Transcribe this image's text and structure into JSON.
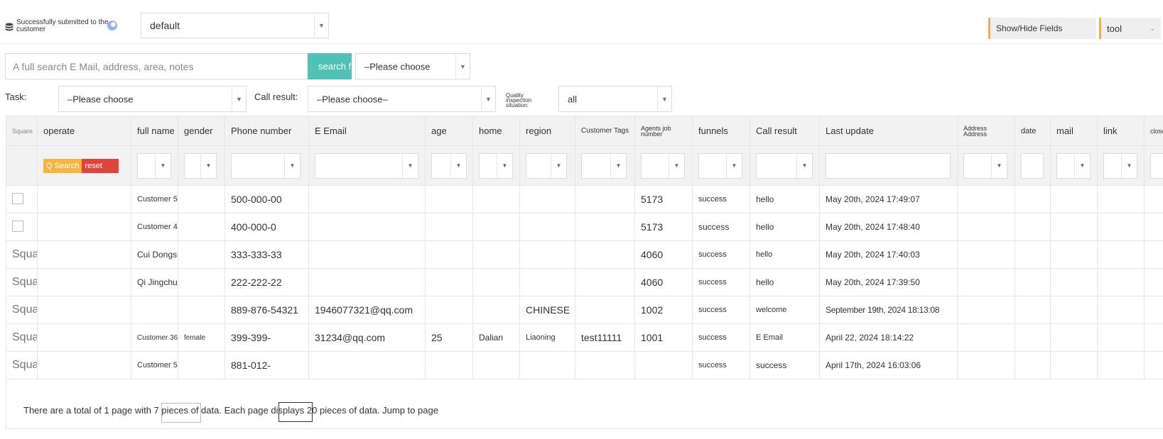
{
  "topbar": {
    "status_text": "Successfully submitted to the customer",
    "view_select": "default",
    "show_hide_label": "Show/Hide Fields",
    "tool_label": "tool"
  },
  "search": {
    "placeholder": "A full search E Mail, address, area, notes",
    "button_label": "search f",
    "choose": "–Please choose"
  },
  "filters": {
    "task_label": "Task:",
    "task_value": "–Please choose",
    "call_label": "Call result:",
    "call_value": "–Please choose–",
    "quality_label": "Quality inspection situation:",
    "quality_value": "all"
  },
  "table": {
    "columns": [
      "Square",
      "operate",
      "full name",
      "gender",
      "Phone number",
      "E Email",
      "age",
      "home",
      "region",
      "Customer Tags",
      "Agents job number",
      "funnels",
      "Call result",
      "Last update",
      "Address Address",
      "date",
      "mail",
      "link",
      "close"
    ],
    "qsearch_label": "Q Search",
    "reset_label": "reset",
    "rows": [
      {
        "square": "",
        "name": "Customer 5",
        "gender": "",
        "phone": "500-000-00",
        "email": "",
        "age": "",
        "home": "",
        "region": "",
        "tags": "",
        "agent": "5173",
        "funnel": "success",
        "call": "hello",
        "updated": "May 20th, 2024 17:49:07"
      },
      {
        "square": "",
        "name": "Customer 4",
        "gender": "",
        "phone": "400-000-0",
        "email": "",
        "age": "",
        "home": "",
        "region": "",
        "tags": "",
        "agent": "5173",
        "funnel": "success",
        "call": "hello",
        "updated": "May 20th, 2024 17:48:40"
      },
      {
        "square": "Square",
        "name": "Cui Dongshan",
        "gender": "",
        "phone": "333-333-33",
        "email": "",
        "age": "",
        "home": "",
        "region": "",
        "tags": "",
        "agent": "4060",
        "funnel": "success",
        "call": "hello",
        "updated": "May 20th, 2024 17:40:03"
      },
      {
        "square": "Square",
        "name": "Qi Jingchun",
        "gender": "",
        "phone": "222-222-22",
        "email": "",
        "age": "",
        "home": "",
        "region": "",
        "tags": "",
        "agent": "4060",
        "funnel": "success",
        "call": "hello",
        "updated": "May 20th, 2024 17:39:50"
      },
      {
        "square": "Square",
        "name": "",
        "gender": "",
        "phone": "889-876-54321",
        "email": "1946077321@qq.com",
        "age": "",
        "home": "",
        "region": "CHINESE",
        "tags": "",
        "agent": "1002",
        "funnel": "success",
        "call": "welcome",
        "updated": "September 19th, 2024 18:13:08"
      },
      {
        "square": "Square",
        "name": "Customer 36",
        "gender": "female",
        "phone": "399-399-",
        "email": "31234@qq.com",
        "age": "25",
        "home": "Dalian",
        "region": "Liaoning",
        "tags": "test11111",
        "agent": "1001",
        "funnel": "success",
        "call": "E Email",
        "updated": "April 22, 2024 18:14:22"
      },
      {
        "square": "Square",
        "name": "Customer 5",
        "gender": "",
        "phone": "881-012-",
        "email": "",
        "age": "",
        "home": "",
        "region": "",
        "tags": "",
        "agent": "",
        "funnel": "success",
        "call": "success",
        "updated": "April 17th, 2024 16:03:06"
      }
    ]
  },
  "pager": {
    "text": "There are a total of 1 page with 7 pieces of data. Each page displays 20 pieces of data. Jump to page"
  }
}
